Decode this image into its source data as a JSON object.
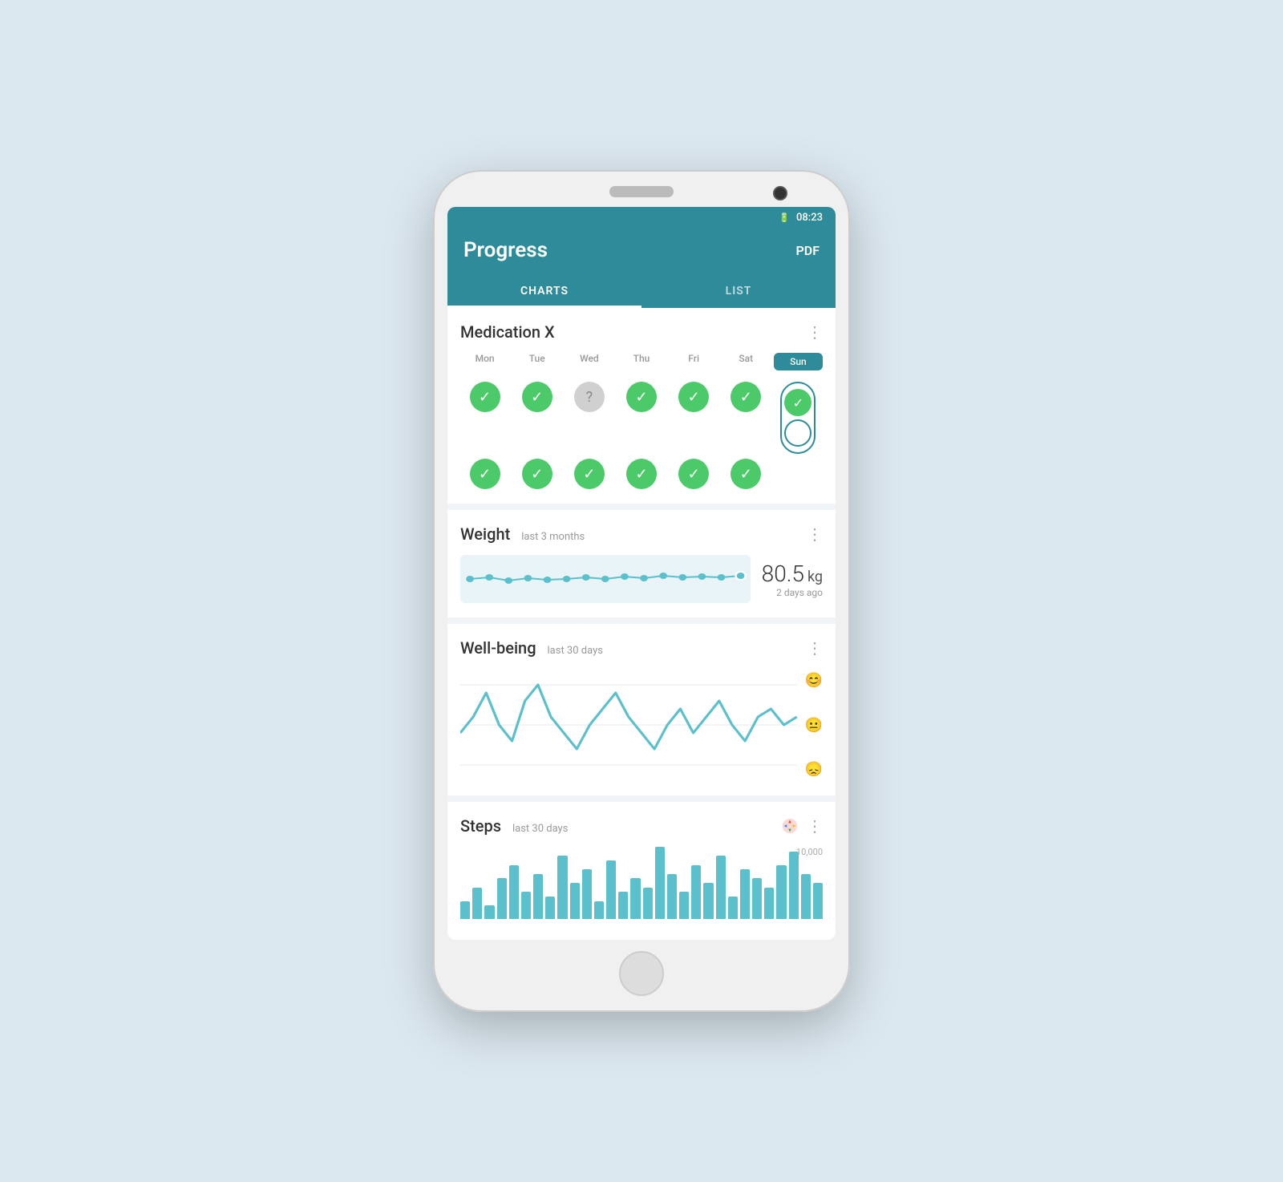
{
  "phone": {
    "time": "08:23",
    "battery_icon": "🔋"
  },
  "header": {
    "title": "Progress",
    "pdf_label": "PDF"
  },
  "tabs": [
    {
      "id": "charts",
      "label": "CHARTS",
      "active": true
    },
    {
      "id": "list",
      "label": "LIST",
      "active": false
    }
  ],
  "cards": {
    "medication": {
      "title": "Medication X",
      "days": [
        "Mon",
        "Tue",
        "Wed",
        "Thu",
        "Fri",
        "Sat",
        "Sun"
      ],
      "row1": [
        "check",
        "check",
        "unknown",
        "check",
        "check",
        "check",
        "check"
      ],
      "row2": [
        "check",
        "check",
        "check",
        "check",
        "check",
        "check",
        "none"
      ]
    },
    "weight": {
      "title": "Weight",
      "subtitle": "last 3 months",
      "value": "80.5",
      "unit": "kg",
      "date": "2 days ago"
    },
    "wellbeing": {
      "title": "Well-being",
      "subtitle": "last 30 days",
      "emoji_top": "😊",
      "emoji_mid": "😐",
      "emoji_low": "😞"
    },
    "steps": {
      "title": "Steps",
      "subtitle": "last 30 days",
      "axis_label": "10,000",
      "bars": [
        20,
        35,
        15,
        45,
        60,
        30,
        50,
        25,
        70,
        40,
        55,
        20,
        65,
        30,
        45,
        35,
        80,
        50,
        30,
        60,
        40,
        70,
        25,
        55,
        45,
        35,
        60,
        75,
        50,
        40
      ]
    }
  }
}
